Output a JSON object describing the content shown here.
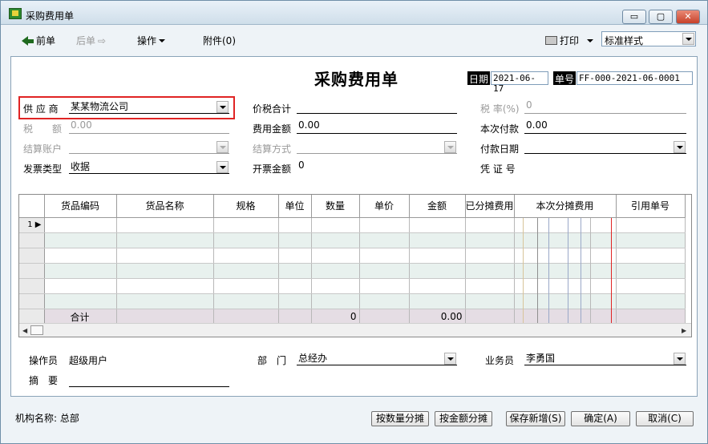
{
  "window": {
    "title": "采购费用单",
    "minimize": "▭",
    "maximize": "▢",
    "close": "✕"
  },
  "toolbar": {
    "prev": "前单",
    "next": "后单",
    "operate": "操作",
    "attach": "附件(0)",
    "print": "打印",
    "style_value": "标准样式"
  },
  "doc": {
    "title": "采购费用单",
    "date_label": "日期",
    "date_value": "2021-06-17",
    "no_label": "单号",
    "no_value": "FF-000-2021-06-0001"
  },
  "fields": {
    "supplier_label": "供 应 商",
    "supplier_value": "某某物流公司",
    "tax_amount_label": "税　　额",
    "tax_amount_value": "0.00",
    "settle_account_label": "结算账户",
    "settle_account_value": "",
    "invoice_type_label": "发票类型",
    "invoice_type_value": "收据",
    "price_tax_total_label": "价税合计",
    "price_tax_total_value": "",
    "fee_amount_label": "费用金额",
    "fee_amount_value": "0.00",
    "settle_method_label": "结算方式",
    "settle_method_value": "",
    "invoice_amount_label": "开票金额",
    "invoice_amount_value": "0",
    "tax_rate_label": "税 率(%)",
    "tax_rate_value": "0",
    "this_payment_label": "本次付款",
    "this_payment_value": "0.00",
    "payment_date_label": "付款日期",
    "payment_date_value": "",
    "voucher_label": "凭 证 号",
    "voucher_value": ""
  },
  "grid": {
    "columns": [
      "",
      "货品编码",
      "货品名称",
      "规格",
      "单位",
      "数量",
      "单价",
      "金额",
      "已分摊费用",
      "本次分摊费用",
      "引用单号"
    ],
    "first_row_number": "1",
    "sum_label": "合计",
    "sum_quantity": "0",
    "sum_amount": "0.00"
  },
  "footer": {
    "operator_label": "操作员",
    "operator_value": "超级用户",
    "department_label": "部　门",
    "department_value": "总经办",
    "salesman_label": "业务员",
    "salesman_value": "李勇国",
    "summary_label": "摘　要",
    "summary_value": ""
  },
  "status": {
    "org": "机构名称: 总部"
  },
  "buttons": {
    "by_quantity": "按数量分摊",
    "by_amount": "按金额分摊",
    "save_new": "保存新增(S)",
    "ok": "确定(A)",
    "cancel": "取消(C)"
  }
}
